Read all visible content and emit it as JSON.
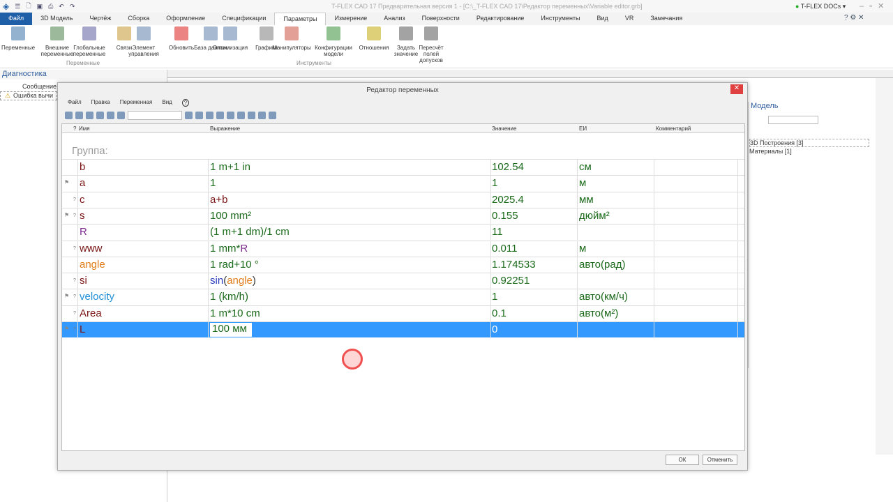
{
  "window": {
    "title": "T-FLEX CAD 17 Предварительная версия 1 - [C:\\_T-FLEX CAD 17\\Редактор переменных\\Variable editor.grb]",
    "docs": "T-FLEX DOCs"
  },
  "tabs": [
    "Файл",
    "3D Модель",
    "Чертёж",
    "Сборка",
    "Оформление",
    "Спецификации",
    "Параметры",
    "Измерение",
    "Анализ",
    "Поверхности",
    "Редактирование",
    "Инструменты",
    "Вид",
    "VR",
    "Замечания"
  ],
  "active_tab": "Параметры",
  "ribbon": {
    "items": [
      "Переменные",
      "Внешние переменные",
      "Глобальные переменные",
      "Связи",
      "Элемент управления",
      "Обновить",
      "База данных",
      "Оптимизация",
      "Графики",
      "Манипуляторы",
      "Конфигурации модели",
      "Отношения",
      "Задать значение",
      "Пересчёт полей допусков"
    ],
    "groups": [
      "Переменные",
      "Инструменты"
    ]
  },
  "diagnostics": {
    "title": "Диагностика",
    "column": "Сообщение",
    "item": "Ошибка вычи"
  },
  "model": {
    "title": "Модель",
    "items": [
      "3D Построения [3]",
      "Материалы [1]"
    ]
  },
  "dialog": {
    "title": "Редактор переменных",
    "menu": [
      "Файл",
      "Правка",
      "Переменная",
      "Вид"
    ],
    "columns": {
      "name": "Имя",
      "expr": "Выражение",
      "value": "Значение",
      "unit": "ЕИ",
      "comment": "Комментарий"
    },
    "group": "Группа:",
    "rows": [
      {
        "name": "b",
        "expr": "1 m+1 in",
        "value": "102.54",
        "unit": "см",
        "flag": false,
        "q": false
      },
      {
        "name": "a",
        "expr": "1",
        "value": "1",
        "unit": "м",
        "flag": true,
        "q": false
      },
      {
        "name": "c",
        "expr": "a+b",
        "value": "2025.4",
        "unit": "мм",
        "flag": false,
        "q": true
      },
      {
        "name": "s",
        "expr": "100 mm²",
        "value": "0.155",
        "unit": "дюйм²",
        "flag": true,
        "q": true
      },
      {
        "name": "R",
        "expr": "(1 m+1 dm)/1 cm",
        "value": "11",
        "unit": "",
        "flag": false,
        "q": false
      },
      {
        "name": "www",
        "expr": "1 mm*R",
        "value": "0.011",
        "unit": "м",
        "flag": false,
        "q": true
      },
      {
        "name": "angle",
        "expr": "1 rad+10 °",
        "value": "1.174533",
        "unit": "авто(рад)",
        "flag": false,
        "q": false
      },
      {
        "name": "si",
        "expr": "sin(angle)",
        "value": "0.92251",
        "unit": "",
        "flag": false,
        "q": true
      },
      {
        "name": "velocity",
        "expr": "1 (km/h)",
        "value": "1",
        "unit": "авто(км/ч)",
        "flag": true,
        "q": true
      },
      {
        "name": "Area",
        "expr": "1 m*10 cm",
        "value": "0.1",
        "unit": "авто(м²)",
        "flag": false,
        "q": true
      },
      {
        "name": "L",
        "expr": "100 мм",
        "value": "0",
        "unit": "",
        "flag": true,
        "q": true,
        "selected": true
      }
    ],
    "ok": "ОК",
    "cancel": "Отменить"
  },
  "colors": {
    "selection": "#3399ff",
    "name": "#7a1414",
    "expression": "#1a6a1a",
    "accent": "#1e5fa8"
  }
}
